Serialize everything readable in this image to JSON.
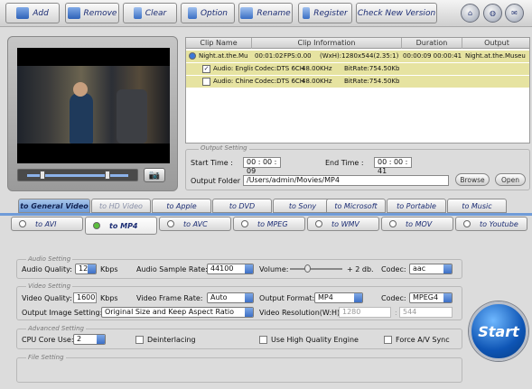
{
  "toolbar": {
    "add": "Add",
    "remove": "Remove",
    "clear": "Clear",
    "option": "Option",
    "rename": "Rename",
    "register": "Register",
    "check_version": "Check New Version",
    "round_icons": [
      "home-icon",
      "globe-icon",
      "mail-icon"
    ]
  },
  "clips": {
    "headers": [
      "Clip Name",
      "Clip Information",
      "Duration",
      "Output"
    ],
    "main": {
      "name": "Night.at.the.Mu",
      "time": "00:01:02",
      "fps": "FPS:0.00",
      "size": "(WxH):1280x544(2.35:1)",
      "duration": "00:00:09 00:00:41",
      "output": "Night.at.the.Museu"
    },
    "audio": [
      {
        "label": "Audio: English",
        "checked": true,
        "codec": "Codec:DTS 6CH",
        "freq": "48.00KHz",
        "bitrate": "BitRate:754.50Kb"
      },
      {
        "label": "Audio: Chinese",
        "checked": false,
        "codec": "Codec:DTS 6CH",
        "freq": "48.00KHz",
        "bitrate": "BitRate:754.50Kb"
      }
    ]
  },
  "output_setting": {
    "title": "Output Setting",
    "start_label": "Start Time :",
    "start_value": "00 : 00 : 09",
    "end_label": "End Time :",
    "end_value": "00 : 00 : 41",
    "folder_label": "Output Folder :",
    "folder_value": "/Users/admin/Movies/MP4",
    "browse": "Browse",
    "open": "Open"
  },
  "tabs": [
    "to General Video",
    "to HD Video",
    "to Apple",
    "to DVD",
    "to Sony",
    "to Microsoft",
    "to Portable",
    "to Music"
  ],
  "subtabs": [
    "to AVI",
    "to MP4",
    "to AVC",
    "to MPEG",
    "to WMV",
    "to MOV",
    "to Youtube"
  ],
  "audio_setting": {
    "title": "Audio Setting",
    "quality_label": "Audio Quality:",
    "quality": "128",
    "kbps": "Kbps",
    "sample_label": "Audio Sample Rate:",
    "sample": "44100",
    "volume_label": "Volume:",
    "volume_value": "+ 2 db.",
    "codec_label": "Codec:",
    "codec": "aac"
  },
  "video_setting": {
    "title": "Video Setting",
    "quality_label": "Video Quality:",
    "quality": "1600",
    "kbps": "Kbps",
    "frame_label": "Video Frame Rate:",
    "frame": "Auto",
    "format_label": "Output Format:",
    "format": "MP4",
    "codec_label": "Codec:",
    "codec": "MPEG4",
    "image_label": "Output Image Setting:",
    "image": "Original Size and Keep Aspect Ratio",
    "res_label": "Video Resolution(W:H):",
    "res_w": "1280",
    "res_sep": ":",
    "res_h": "544"
  },
  "advanced_setting": {
    "title": "Advanced Setting",
    "cpu_label": "CPU Core Use:",
    "cpu": "2",
    "deinterlacing": "Deinterlacing",
    "hq": "Use High Quality Engine",
    "force_av": "Force A/V Sync"
  },
  "file_setting": {
    "title": "File Setting"
  },
  "start_button": "Start"
}
